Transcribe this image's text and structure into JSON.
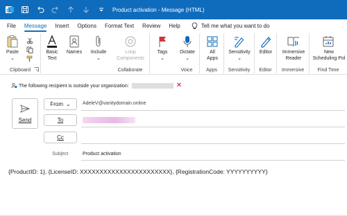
{
  "titlebar": {
    "title": "Product activation  -  Message (HTML)",
    "icons": [
      "outlook-icon",
      "save-icon",
      "undo-icon",
      "redo-icon",
      "up-icon",
      "down-icon",
      "customize-icon"
    ]
  },
  "menu": {
    "tabs": [
      "File",
      "Message",
      "Insert",
      "Options",
      "Format Text",
      "Review",
      "Help"
    ],
    "active": "Message",
    "tell_me": "Tell me what you want to do"
  },
  "ribbon": {
    "groups": {
      "clipboard": "Clipboard",
      "collaborate": "Collaborate",
      "voice": "Voice",
      "apps": "Apps",
      "sensitivity": "Sensitivity",
      "editor": "Editor",
      "immersive": "Immersive",
      "find_time": "Find Time"
    },
    "buttons": {
      "paste": "Paste",
      "basic_text_1": "Basic",
      "basic_text_2": "Text",
      "names": "Names",
      "include": "Include",
      "loop_1": "Loop",
      "loop_2": "Components",
      "tags": "Tags",
      "dictate": "Dictate",
      "all_apps_1": "All",
      "all_apps_2": "Apps",
      "sensitivity": "Sensitivity",
      "editor": "Editor",
      "immersive_1": "Immersive",
      "immersive_2": "Reader",
      "new_sched_1": "New",
      "new_sched_2": "Scheduling Pol"
    }
  },
  "infobar": {
    "text": "The following recipient is outside your organization:"
  },
  "compose": {
    "send": "Send",
    "from_label": "From",
    "from_value": "AdeleV@vanitydomain.online",
    "to_label": "To",
    "cc_label": "Cc",
    "subject_label": "Subject",
    "subject_value": "Product activation"
  },
  "body": {
    "text": "{ProductID: 1}, {LicenseID: XXXXXXXXXXXXXXXXXXXXXXX}, {RegistrationCode: YYYYYYYYYY}"
  },
  "colors": {
    "accent": "#0f6cbd",
    "warning_x": "#c50f1f"
  }
}
